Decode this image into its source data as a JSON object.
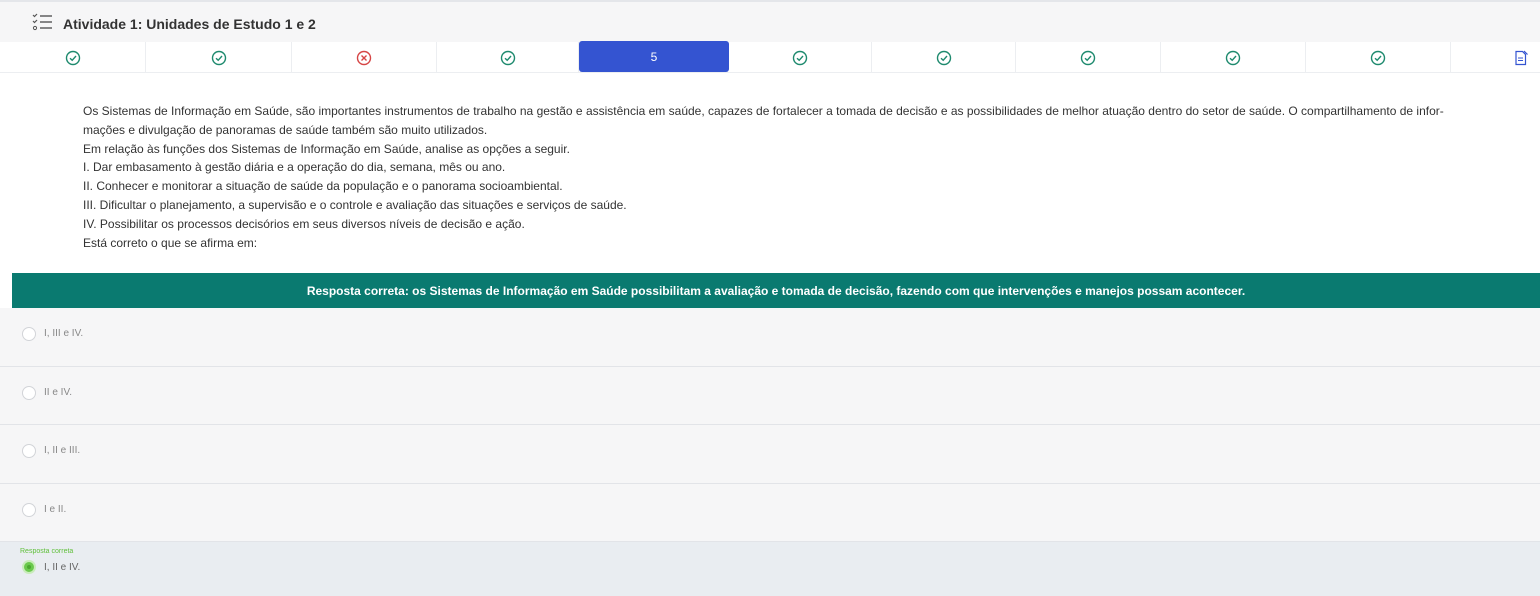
{
  "header": {
    "icon": "list-check-icon",
    "title": "Atividade 1: Unidades de Estudo 1 e 2"
  },
  "question_nav": {
    "items": [
      {
        "status": "correct",
        "icon": "check-circle-icon"
      },
      {
        "status": "correct",
        "icon": "check-circle-icon"
      },
      {
        "status": "wrong",
        "icon": "x-circle-icon"
      },
      {
        "status": "correct",
        "icon": "check-circle-icon"
      },
      {
        "status": "current",
        "label": "5"
      },
      {
        "status": "correct",
        "icon": "check-circle-icon"
      },
      {
        "status": "correct",
        "icon": "check-circle-icon"
      },
      {
        "status": "correct",
        "icon": "check-circle-icon"
      },
      {
        "status": "correct",
        "icon": "check-circle-icon"
      },
      {
        "status": "correct",
        "icon": "check-circle-icon"
      }
    ],
    "end_icon": "document-edit-icon",
    "colors": {
      "correct": "#1e8a6e",
      "wrong": "#d64545",
      "current": "#3454d1"
    }
  },
  "question": {
    "lines": [
      "Os Sistemas de Informação em Saúde, são importantes instrumentos de trabalho na gestão e assistência em saúde, capazes de fortalecer a tomada de decisão e as possibilidades de melhor atuação dentro do setor de saúde. O compartilhamento de infor-",
      "mações e divulgação de panoramas de saúde também são muito utilizados.",
      "Em relação às funções dos Sistemas de Informação em Saúde, analise as opções a seguir.",
      "I. Dar embasamento à gestão diária e a operação do dia, semana, mês ou ano.",
      "II. Conhecer e monitorar a situação de saúde da população e o panorama socioambiental.",
      "III. Dificultar o planejamento, a supervisão e o controle e avaliação das situações e serviços de saúde.",
      "IV. Possibilitar os processos decisórios em seus diversos níveis de decisão e ação.",
      "Está correto o que se afirma em:"
    ]
  },
  "feedback": {
    "text": "Resposta correta: os Sistemas de Informação em Saúde possibilitam a avaliação e tomada de decisão, fazendo com que intervenções e manejos possam acontecer.",
    "color": "#0a7a70"
  },
  "options": [
    {
      "label": "I, III e IV."
    },
    {
      "label": "II e IV."
    },
    {
      "label": "I, II e III."
    },
    {
      "label": "I e II."
    }
  ],
  "correct_answer": {
    "caption": "Resposta correta",
    "label": "I, II e IV.",
    "color": "#6ac94c"
  }
}
